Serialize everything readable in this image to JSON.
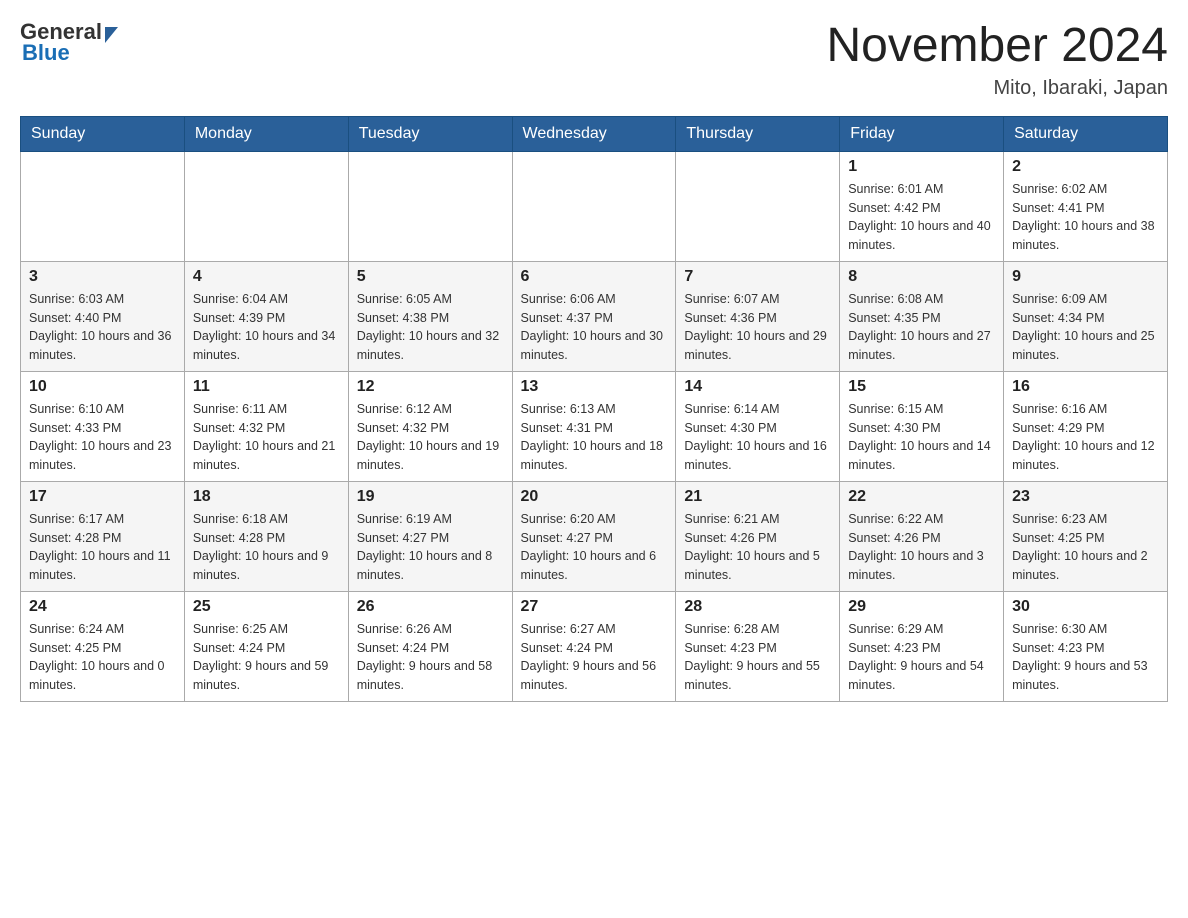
{
  "header": {
    "logo_text_general": "General",
    "logo_text_blue": "Blue",
    "month_title": "November 2024",
    "location": "Mito, Ibaraki, Japan"
  },
  "weekdays": [
    "Sunday",
    "Monday",
    "Tuesday",
    "Wednesday",
    "Thursday",
    "Friday",
    "Saturday"
  ],
  "weeks": [
    {
      "days": [
        {
          "number": "",
          "info": ""
        },
        {
          "number": "",
          "info": ""
        },
        {
          "number": "",
          "info": ""
        },
        {
          "number": "",
          "info": ""
        },
        {
          "number": "",
          "info": ""
        },
        {
          "number": "1",
          "info": "Sunrise: 6:01 AM\nSunset: 4:42 PM\nDaylight: 10 hours and 40 minutes."
        },
        {
          "number": "2",
          "info": "Sunrise: 6:02 AM\nSunset: 4:41 PM\nDaylight: 10 hours and 38 minutes."
        }
      ]
    },
    {
      "days": [
        {
          "number": "3",
          "info": "Sunrise: 6:03 AM\nSunset: 4:40 PM\nDaylight: 10 hours and 36 minutes."
        },
        {
          "number": "4",
          "info": "Sunrise: 6:04 AM\nSunset: 4:39 PM\nDaylight: 10 hours and 34 minutes."
        },
        {
          "number": "5",
          "info": "Sunrise: 6:05 AM\nSunset: 4:38 PM\nDaylight: 10 hours and 32 minutes."
        },
        {
          "number": "6",
          "info": "Sunrise: 6:06 AM\nSunset: 4:37 PM\nDaylight: 10 hours and 30 minutes."
        },
        {
          "number": "7",
          "info": "Sunrise: 6:07 AM\nSunset: 4:36 PM\nDaylight: 10 hours and 29 minutes."
        },
        {
          "number": "8",
          "info": "Sunrise: 6:08 AM\nSunset: 4:35 PM\nDaylight: 10 hours and 27 minutes."
        },
        {
          "number": "9",
          "info": "Sunrise: 6:09 AM\nSunset: 4:34 PM\nDaylight: 10 hours and 25 minutes."
        }
      ]
    },
    {
      "days": [
        {
          "number": "10",
          "info": "Sunrise: 6:10 AM\nSunset: 4:33 PM\nDaylight: 10 hours and 23 minutes."
        },
        {
          "number": "11",
          "info": "Sunrise: 6:11 AM\nSunset: 4:32 PM\nDaylight: 10 hours and 21 minutes."
        },
        {
          "number": "12",
          "info": "Sunrise: 6:12 AM\nSunset: 4:32 PM\nDaylight: 10 hours and 19 minutes."
        },
        {
          "number": "13",
          "info": "Sunrise: 6:13 AM\nSunset: 4:31 PM\nDaylight: 10 hours and 18 minutes."
        },
        {
          "number": "14",
          "info": "Sunrise: 6:14 AM\nSunset: 4:30 PM\nDaylight: 10 hours and 16 minutes."
        },
        {
          "number": "15",
          "info": "Sunrise: 6:15 AM\nSunset: 4:30 PM\nDaylight: 10 hours and 14 minutes."
        },
        {
          "number": "16",
          "info": "Sunrise: 6:16 AM\nSunset: 4:29 PM\nDaylight: 10 hours and 12 minutes."
        }
      ]
    },
    {
      "days": [
        {
          "number": "17",
          "info": "Sunrise: 6:17 AM\nSunset: 4:28 PM\nDaylight: 10 hours and 11 minutes."
        },
        {
          "number": "18",
          "info": "Sunrise: 6:18 AM\nSunset: 4:28 PM\nDaylight: 10 hours and 9 minutes."
        },
        {
          "number": "19",
          "info": "Sunrise: 6:19 AM\nSunset: 4:27 PM\nDaylight: 10 hours and 8 minutes."
        },
        {
          "number": "20",
          "info": "Sunrise: 6:20 AM\nSunset: 4:27 PM\nDaylight: 10 hours and 6 minutes."
        },
        {
          "number": "21",
          "info": "Sunrise: 6:21 AM\nSunset: 4:26 PM\nDaylight: 10 hours and 5 minutes."
        },
        {
          "number": "22",
          "info": "Sunrise: 6:22 AM\nSunset: 4:26 PM\nDaylight: 10 hours and 3 minutes."
        },
        {
          "number": "23",
          "info": "Sunrise: 6:23 AM\nSunset: 4:25 PM\nDaylight: 10 hours and 2 minutes."
        }
      ]
    },
    {
      "days": [
        {
          "number": "24",
          "info": "Sunrise: 6:24 AM\nSunset: 4:25 PM\nDaylight: 10 hours and 0 minutes."
        },
        {
          "number": "25",
          "info": "Sunrise: 6:25 AM\nSunset: 4:24 PM\nDaylight: 9 hours and 59 minutes."
        },
        {
          "number": "26",
          "info": "Sunrise: 6:26 AM\nSunset: 4:24 PM\nDaylight: 9 hours and 58 minutes."
        },
        {
          "number": "27",
          "info": "Sunrise: 6:27 AM\nSunset: 4:24 PM\nDaylight: 9 hours and 56 minutes."
        },
        {
          "number": "28",
          "info": "Sunrise: 6:28 AM\nSunset: 4:23 PM\nDaylight: 9 hours and 55 minutes."
        },
        {
          "number": "29",
          "info": "Sunrise: 6:29 AM\nSunset: 4:23 PM\nDaylight: 9 hours and 54 minutes."
        },
        {
          "number": "30",
          "info": "Sunrise: 6:30 AM\nSunset: 4:23 PM\nDaylight: 9 hours and 53 minutes."
        }
      ]
    }
  ]
}
